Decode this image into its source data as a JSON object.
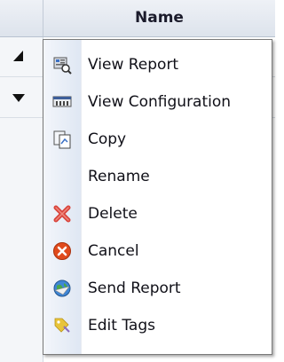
{
  "grid": {
    "header_name": "Name"
  },
  "context_menu": {
    "items": [
      {
        "label": "View Report",
        "icon": "view-report-icon"
      },
      {
        "label": "View Configuration",
        "icon": "view-configuration-icon"
      },
      {
        "label": "Copy",
        "icon": "copy-icon"
      },
      {
        "label": "Rename",
        "icon": ""
      },
      {
        "label": "Delete",
        "icon": "delete-icon"
      },
      {
        "label": "Cancel",
        "icon": "cancel-icon"
      },
      {
        "label": "Send Report",
        "icon": "send-report-icon"
      },
      {
        "label": "Edit Tags",
        "icon": "edit-tags-icon"
      }
    ]
  },
  "colors": {
    "delete_accent": "#d9443c",
    "cancel_accent": "#e04a1c",
    "tags_accent": "#e8c43a"
  }
}
